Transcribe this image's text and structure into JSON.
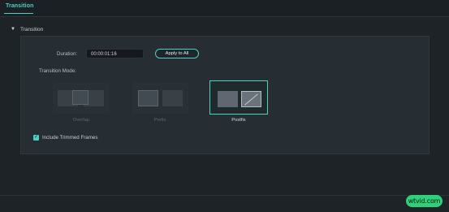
{
  "tabs": {
    "active_label": "Transition"
  },
  "section": {
    "title": "Transition",
    "caret_icon": "caret-down-icon"
  },
  "duration": {
    "label": "Duration:",
    "value": "00:00:01:16"
  },
  "apply_button": {
    "label": "Apply to All"
  },
  "transition_mode": {
    "label": "Transition Mode:",
    "options": [
      {
        "label": "Overlap",
        "state": "disabled"
      },
      {
        "label": "Prefix",
        "state": "disabled"
      },
      {
        "label": "Postfix",
        "state": "selected"
      }
    ]
  },
  "include_trimmed": {
    "label": "Include Trimmed Frames",
    "checked": true
  },
  "watermark": {
    "text": "wtvid.com"
  },
  "colors": {
    "accent": "#4fcfbf",
    "background": "#1e2328",
    "panel": "#262d33",
    "watermark": "#2fd07a"
  }
}
